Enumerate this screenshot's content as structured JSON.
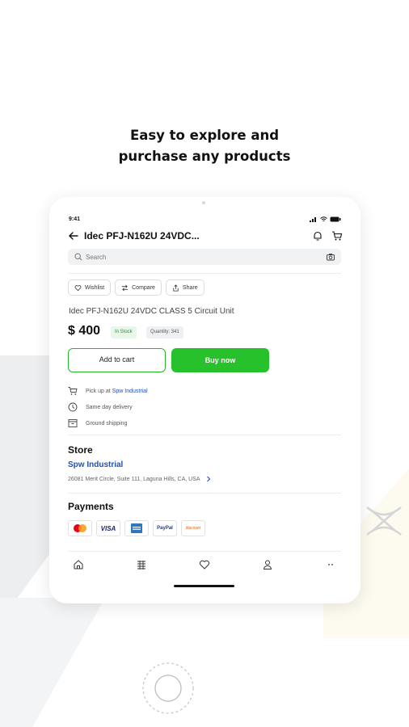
{
  "headline": {
    "line1": "Easy to explore and",
    "line2": "purchase any products"
  },
  "status_bar": {
    "time": "9:41"
  },
  "header": {
    "title": "Idec PFJ-N162U 24VDC..."
  },
  "search": {
    "placeholder": "Search"
  },
  "actions": {
    "wishlist": "Wishlist",
    "compare": "Compare",
    "share": "Share"
  },
  "product": {
    "name": "Idec PFJ-N162U 24VDC CLASS 5 Circuit Unit",
    "price": "$ 400",
    "stock_badge": "In Stock",
    "quantity_badge": "Quantity: 341"
  },
  "buttons": {
    "add_to_cart": "Add to cart",
    "buy_now": "Buy now"
  },
  "fulfillment": {
    "pickup_prefix": "Pick up at",
    "pickup_store": "Spw Industrial",
    "same_day": "Same day delivery",
    "ground": "Ground shipping"
  },
  "store": {
    "section_title": "Store",
    "name": "Spw Industrial",
    "address": "26081 Merit Circle, Suite 111, Laguna Hills, CA, USA"
  },
  "payments": {
    "section_title": "Payments",
    "methods": [
      "Mastercard",
      "VISA",
      "Amex",
      "PayPal",
      "discover"
    ]
  },
  "colors": {
    "accent_green": "#27c22b",
    "link_blue": "#1c4fc4"
  },
  "tabbar": {
    "icons": [
      "home-icon",
      "catalog-icon",
      "heart-icon",
      "profile-icon",
      "more-icon"
    ]
  }
}
